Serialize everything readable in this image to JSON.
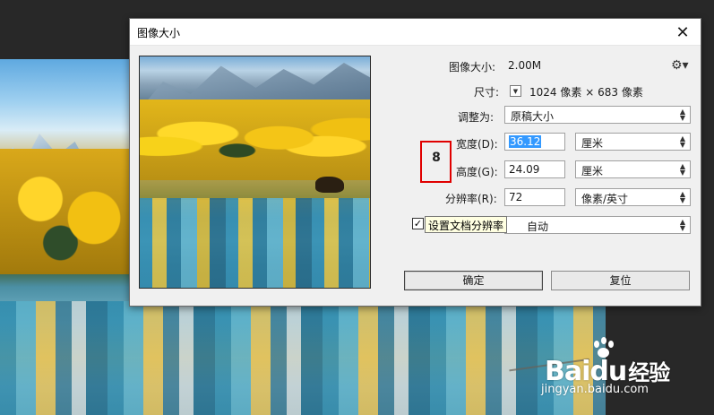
{
  "dialog": {
    "title": "图像大小",
    "close_label": "✕"
  },
  "image_size": {
    "label": "图像大小:",
    "value": "2.00M"
  },
  "dimensions": {
    "label": "尺寸:",
    "width_px": "1024",
    "height_px": "683",
    "unit": "像素",
    "separator": "×"
  },
  "fit_to": {
    "label": "调整为:",
    "selected": "原稿大小"
  },
  "width": {
    "label": "宽度(D):",
    "value": "36.12",
    "unit": "厘米"
  },
  "height": {
    "label": "高度(G):",
    "value": "24.09",
    "unit": "厘米"
  },
  "resolution": {
    "label": "分辨率(R):",
    "value": "72",
    "unit": "像素/英寸"
  },
  "resample": {
    "checked": true,
    "selected": "自动",
    "tooltip": "设置文档分辨率"
  },
  "buttons": {
    "ok": "确定",
    "reset": "复位"
  },
  "watermark": {
    "logo_left": "Bai",
    "logo_right": "du",
    "logo_cn": "经验",
    "url": "jingyan.baidu.com"
  },
  "colors": {
    "dialog_bg": "#f0f0f0",
    "selection": "#3399ff",
    "highlight_box": "#e00000",
    "tooltip_bg": "#ffffe1"
  },
  "icons": {
    "gear": "gear-icon",
    "link": "chain-link-icon",
    "dropdown": "chevron-down-icon"
  }
}
